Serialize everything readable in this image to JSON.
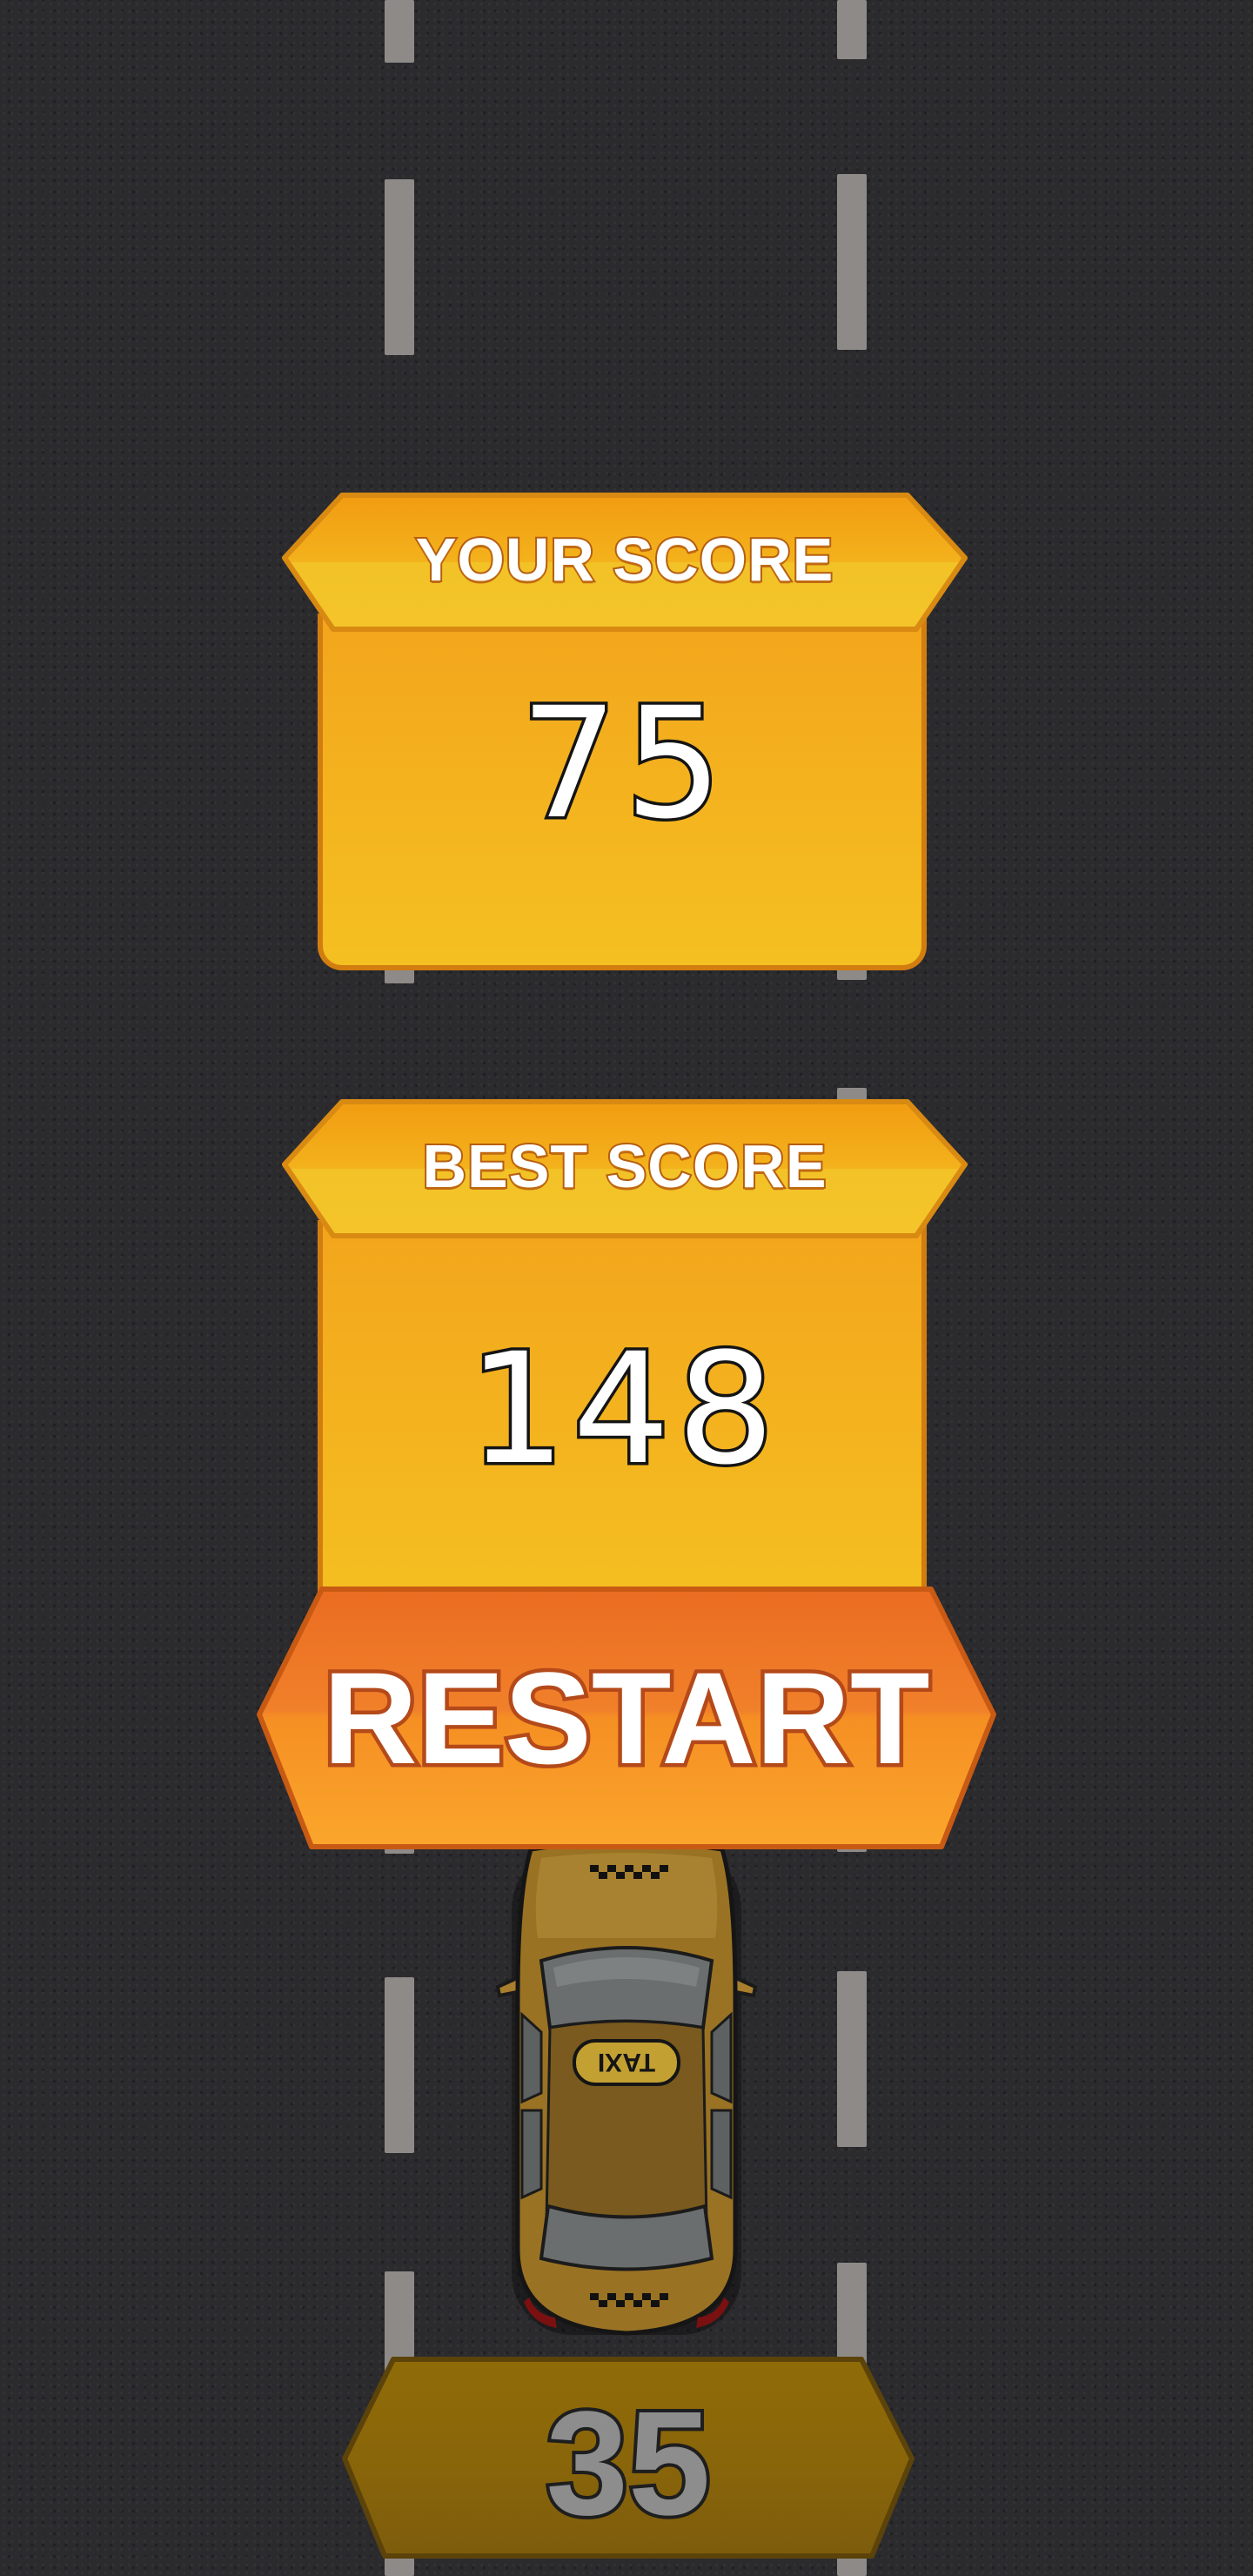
{
  "your_score": {
    "label": "YOUR SCORE",
    "value": "75"
  },
  "best_score": {
    "label": "BEST SCORE",
    "value": "148"
  },
  "restart": {
    "label": "RESTART"
  },
  "speed": {
    "value": "35"
  },
  "taxi": {
    "roof_sign": "TAXI"
  },
  "colors": {
    "road": "#2b2b2e",
    "lane_marking": "#8e8a88",
    "panel_yellow": "#f4b51e",
    "panel_border": "#d27d10",
    "restart_orange": "#f58a1f",
    "speed_badge": "#8f6a0a"
  },
  "icons": [
    "taxi-car-icon"
  ]
}
